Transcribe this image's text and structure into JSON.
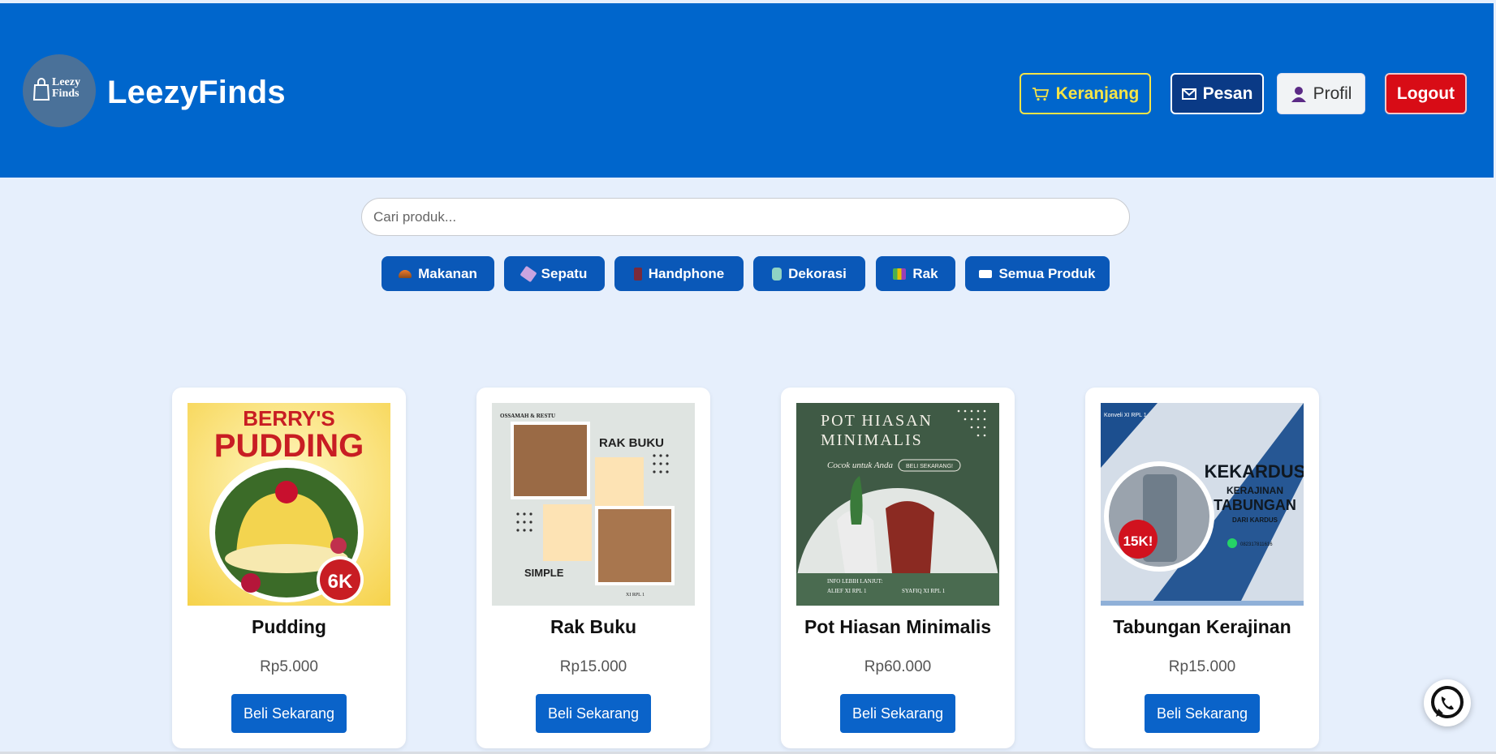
{
  "header": {
    "logo_text_line1": "Leezy",
    "logo_text_line2": "Finds",
    "brand": "LeezyFinds",
    "nav": [
      {
        "label": "Keranjang",
        "icon": "cart-icon"
      },
      {
        "label": "Pesan",
        "icon": "envelope-icon"
      },
      {
        "label": "Profil",
        "icon": "user-icon"
      },
      {
        "label": "Logout"
      }
    ]
  },
  "search": {
    "placeholder": "Cari produk..."
  },
  "categories": [
    {
      "label": "Makanan",
      "icon": "food-icon"
    },
    {
      "label": "Sepatu",
      "icon": "shoe-icon"
    },
    {
      "label": "Handphone",
      "icon": "phone-icon"
    },
    {
      "label": "Dekorasi",
      "icon": "decoration-icon"
    },
    {
      "label": "Rak",
      "icon": "books-icon"
    },
    {
      "label": "Semua Produk",
      "icon": "bed-icon"
    }
  ],
  "products": [
    {
      "name": "Pudding",
      "price": "Rp5.000",
      "button": "Beli Sekarang",
      "image": {
        "title_line1": "BERRY'S",
        "title_line2": "PUDDING",
        "badge": "6K"
      }
    },
    {
      "name": "Rak Buku",
      "price": "Rp15.000",
      "button": "Beli Sekarang",
      "image": {
        "top": "OSSAMAH & RESTU",
        "title": "RAK BUKU",
        "subtitle": "SIMPLE",
        "class": "XI RPL 1"
      }
    },
    {
      "name": "Pot Hiasan Minimalis",
      "price": "Rp60.000",
      "button": "Beli Sekarang",
      "image": {
        "title_line1": "POT HIASAN",
        "title_line2": "MINIMALIS",
        "script": "Cocok untuk Anda",
        "cta": "BELI SEKARANG!",
        "info": "INFO LEBIH LANJUT:",
        "contact1": "ALIEF XI RPL 1",
        "contact2": "SYAFIQ XI RPL 1"
      }
    },
    {
      "name": "Tabungan Kerajinan",
      "price": "Rp15.000",
      "button": "Beli Sekarang",
      "image": {
        "top": "Konveli XI RPL 1",
        "title": "KEKARDUS",
        "line2": "KERAJINAN",
        "line3": "TABUNGAN",
        "line4": "DARI KARDUS",
        "badge": "15K!",
        "phone": "082317811616"
      }
    }
  ],
  "colors": {
    "header": "#0066cc",
    "background": "#e6effc",
    "accent": "#0a63c9",
    "logout": "#d80c16",
    "cart": "#f5e447"
  }
}
